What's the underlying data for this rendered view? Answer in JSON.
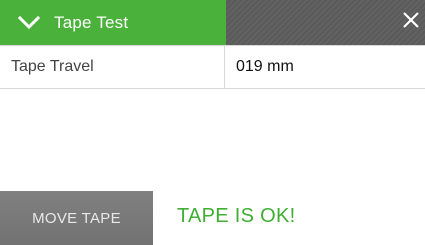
{
  "header": {
    "title": "Tape Test",
    "collapse_icon": "chevron-down-icon",
    "close_icon": "close-icon"
  },
  "table": {
    "rows": [
      {
        "label": "Tape Travel",
        "value": "019 mm"
      }
    ]
  },
  "actions": {
    "move_tape_label": "MOVE TAPE"
  },
  "status": {
    "text": "TAPE IS OK!"
  },
  "colors": {
    "accent_green": "#4ab23a",
    "status_green": "#3fae33",
    "title_gray": "#5a5a5a",
    "button_gray": "#7a7a7a"
  }
}
